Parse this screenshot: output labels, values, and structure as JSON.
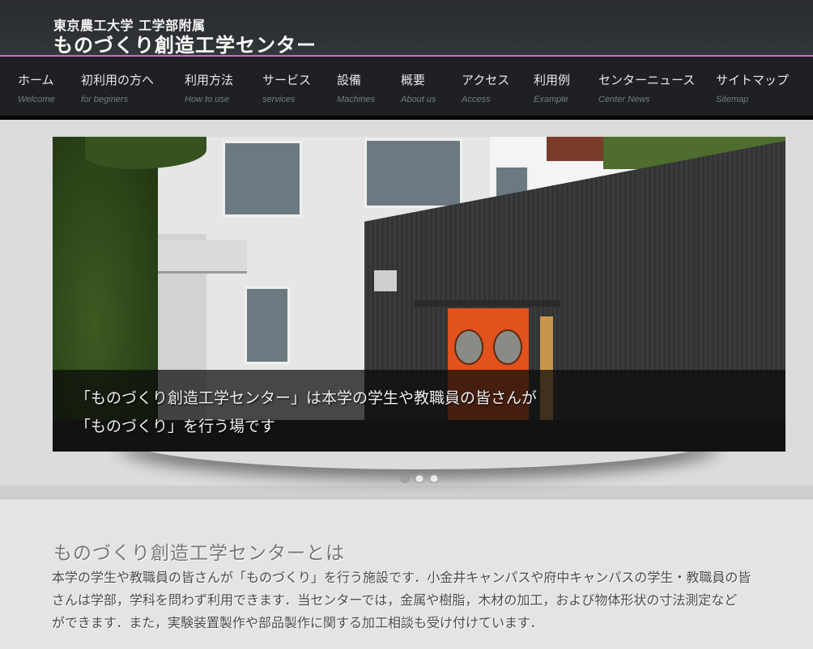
{
  "header": {
    "subtitle": "東京農工大学 工学部附属",
    "title": "ものづくり創造工学センター",
    "accent_color": "#c56fc4"
  },
  "nav": {
    "items": [
      {
        "jp": "ホーム",
        "en": "Welcome"
      },
      {
        "jp": "初利用の方へ",
        "en": "for beginers"
      },
      {
        "jp": "利用方法",
        "en": "How to use"
      },
      {
        "jp": "サービス",
        "en": "services"
      },
      {
        "jp": "設備",
        "en": "Machines"
      },
      {
        "jp": "概要",
        "en": "About us"
      },
      {
        "jp": "アクセス",
        "en": "Access"
      },
      {
        "jp": "利用例",
        "en": "Example"
      },
      {
        "jp": "センターニュース",
        "en": "Center News"
      },
      {
        "jp": "サイトマップ",
        "en": "Sitemap"
      }
    ]
  },
  "slider": {
    "caption_line1": "「ものづくり創造工学センター」は本学の学生や教職員の皆さんが",
    "caption_line2": "「ものづくり」を行う場です",
    "image_alt": "center-building-photo",
    "total_slides": 3,
    "active_slide": 1
  },
  "about": {
    "title": "ものづくり創造工学センターとは",
    "lines": [
      "本学の学生や教職員の皆さんが「ものづくり」を行う施設です．小金井キャンパスや府中キャンパスの学生・教職員の皆",
      "さんは学部，学科を問わず利用できます．当センターでは，金属や樹脂，木材の加工，および物体形状の寸法測定など",
      "ができます．また，実験装置製作や部品製作に関する加工相談も受け付けています．"
    ]
  }
}
